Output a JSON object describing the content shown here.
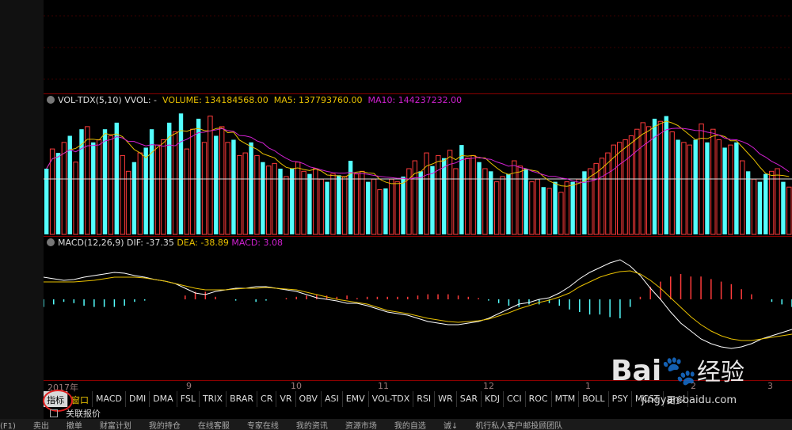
{
  "volume_panel": {
    "name": "VOL-TDX(5,10)",
    "vvol_label": "VVOL: -",
    "volume_label": "VOLUME: 134184568.00",
    "ma5_label": "MA5: 137793760.00",
    "ma10_label": "MA10: 144237232.00"
  },
  "macd_panel": {
    "name": "MACD(12,26,9)",
    "dif_label": "DIF: -37.35",
    "dea_label": "DEA: -38.89",
    "macd_label": "MACD: 3.08"
  },
  "x_axis": {
    "labels": [
      "2017年",
      "9",
      "10",
      "11",
      "12",
      "1",
      "2",
      "3"
    ]
  },
  "tabs": [
    "指标",
    "窗口",
    "MACD",
    "DMI",
    "DMA",
    "FSL",
    "TRIX",
    "BRAR",
    "CR",
    "VR",
    "OBV",
    "ASI",
    "EMV",
    "VOL-TDX",
    "RSI",
    "WR",
    "SAR",
    "KDJ",
    "CCI",
    "ROC",
    "MTM",
    "BOLL",
    "PSY",
    "MCST",
    "更多"
  ],
  "link_bar": {
    "label": "关联报价"
  },
  "status_bar": [
    "(F1)",
    "卖出",
    "撤单",
    "财富计划",
    "我的持仓",
    "在线客服",
    "专家在线",
    "我的资讯",
    "资源市场",
    "我的自选",
    "诚↓",
    "机行私人客户邮投顾团队"
  ],
  "watermark": {
    "brand": "Bai",
    "text": "经验",
    "url": "jingyan.baidu.com"
  },
  "colors": {
    "up": "#ff3b3b",
    "down": "#54ffff",
    "dif": "#ffffff",
    "dea": "#e8c000",
    "ma10": "#d020d0",
    "grid": "#8a0000"
  },
  "chart_data": [
    {
      "type": "bar",
      "title": "VOL-TDX(5,10)",
      "series": [
        {
          "name": "VOLUME",
          "values": [
            50,
            65,
            62,
            70,
            75,
            55,
            80,
            82,
            70,
            72,
            80,
            75,
            85,
            60,
            48,
            55,
            62,
            66,
            80,
            68,
            72,
            85,
            78,
            92,
            65,
            80,
            88,
            70,
            90,
            75,
            82,
            70,
            72,
            60,
            62,
            70,
            60,
            55,
            52,
            54,
            50,
            44,
            50,
            55,
            48,
            46,
            50,
            42,
            40,
            46,
            45,
            44,
            56,
            46,
            48,
            40,
            42,
            34,
            35,
            42,
            40,
            44,
            50,
            56,
            48,
            62,
            52,
            60,
            58,
            64,
            50,
            68,
            58,
            60,
            55,
            50,
            48,
            40,
            44,
            46,
            56,
            52,
            50,
            40,
            42,
            36,
            35,
            40,
            32,
            40,
            40,
            42,
            48,
            50,
            54,
            58,
            62,
            68,
            70,
            72,
            75,
            80,
            85,
            82,
            88,
            86,
            90,
            78,
            72,
            70,
            68,
            72,
            84,
            70,
            80,
            72,
            66,
            68,
            70,
            56,
            48,
            42,
            40,
            46,
            48,
            50,
            40,
            36
          ],
          "up": [
            0,
            1,
            0,
            1,
            0,
            1,
            0,
            1,
            0,
            1,
            0,
            1,
            0,
            1,
            1,
            0,
            1,
            0,
            0,
            1,
            1,
            0,
            1,
            0,
            1,
            1,
            0,
            1,
            1,
            0,
            1,
            1,
            0,
            1,
            1,
            0,
            1,
            0,
            1,
            1,
            0,
            1,
            0,
            1,
            1,
            0,
            1,
            1,
            0,
            1,
            0,
            1,
            0,
            1,
            1,
            0,
            1,
            1,
            0,
            1,
            1,
            0,
            1,
            1,
            0,
            1,
            0,
            1,
            0,
            1,
            1,
            0,
            1,
            1,
            0,
            1,
            0,
            1,
            1,
            0,
            1,
            1,
            0,
            1,
            1,
            0,
            1,
            0,
            1,
            1,
            0,
            1,
            0,
            1,
            1,
            1,
            1,
            1,
            1,
            1,
            1,
            1,
            1,
            1,
            0,
            1,
            0,
            1,
            0,
            1,
            1,
            0,
            1,
            0,
            1,
            1,
            0,
            1,
            0,
            1,
            0,
            1,
            0,
            0,
            1,
            1,
            0,
            1
          ]
        },
        {
          "name": "MA5",
          "values": []
        },
        {
          "name": "MA10",
          "values": []
        }
      ]
    },
    {
      "type": "line",
      "title": "MACD(12,26,9)",
      "series": [
        {
          "name": "DIF",
          "values": [
            52,
            54,
            56,
            55,
            52,
            50,
            48,
            46,
            47,
            50,
            52,
            55,
            57,
            60,
            66,
            72,
            74,
            70,
            68,
            66,
            66,
            64,
            64,
            66,
            68,
            70,
            74,
            78,
            80,
            82,
            85,
            85,
            88,
            92,
            96,
            98,
            100,
            104,
            108,
            110,
            112,
            112,
            110,
            108,
            104,
            98,
            92,
            86,
            84,
            80,
            78,
            72,
            64,
            54,
            46,
            40,
            34,
            30,
            38,
            50,
            66,
            80,
            96,
            110,
            120,
            130,
            136,
            140,
            142,
            140,
            136,
            130,
            126,
            122,
            118
          ]
        },
        {
          "name": "DEA",
          "values": [
            58,
            58,
            58,
            58,
            57,
            56,
            54,
            52,
            52,
            52,
            53,
            55,
            57,
            60,
            63,
            66,
            68,
            68,
            68,
            67,
            66,
            66,
            65,
            66,
            67,
            68,
            71,
            74,
            77,
            80,
            82,
            84,
            86,
            90,
            94,
            96,
            98,
            101,
            104,
            106,
            108,
            109,
            108,
            107,
            105,
            101,
            97,
            92,
            88,
            84,
            81,
            77,
            72,
            64,
            58,
            52,
            48,
            45,
            44,
            48,
            56,
            66,
            78,
            90,
            102,
            112,
            120,
            126,
            130,
            132,
            132,
            130,
            128,
            126,
            124
          ]
        },
        {
          "name": "MACD",
          "values": []
        }
      ]
    }
  ]
}
